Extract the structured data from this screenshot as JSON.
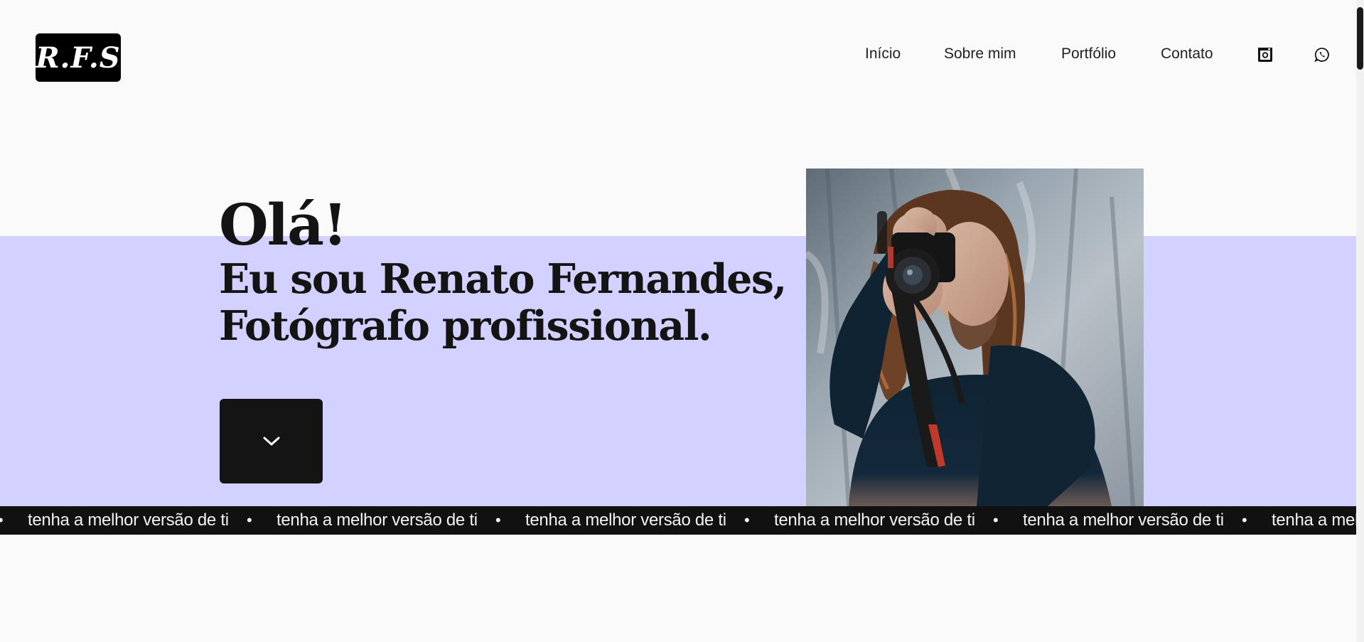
{
  "header": {
    "logo_text": "R.F.S",
    "nav": [
      {
        "label": "Início"
      },
      {
        "label": "Sobre mim"
      },
      {
        "label": "Portfólio"
      },
      {
        "label": "Contato"
      }
    ],
    "icons": [
      "instagram-icon",
      "whatsapp-icon"
    ]
  },
  "hero": {
    "greeting": "Olá!",
    "headline_line1": "Eu sou Renato Fernandes,",
    "headline_line2": "Fotógrafo profissional.",
    "scroll_button_icon": "chevron-down-icon",
    "photo_icon": "photographer-photo"
  },
  "marquee": {
    "text": "tenha a melhor versão de ti",
    "separator": "•"
  },
  "colors": {
    "background": "#fafafa",
    "band": "#d2d1ff",
    "dark": "#111111",
    "text": "#141414"
  }
}
